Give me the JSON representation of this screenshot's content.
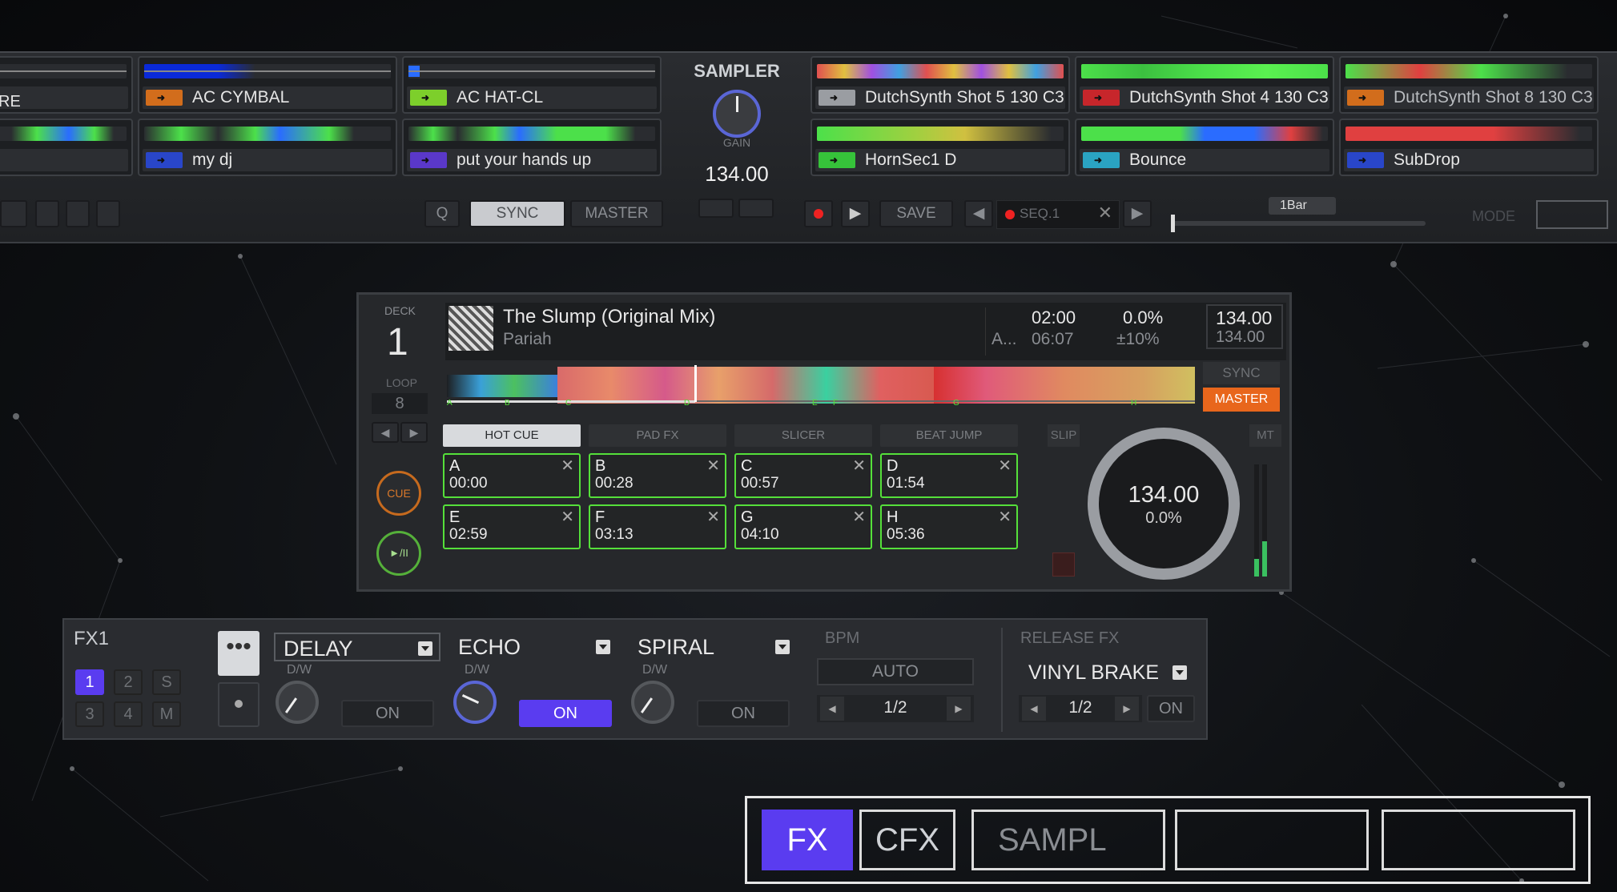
{
  "sampler": {
    "label": "SAMPLER",
    "gain_label": "GAIN",
    "bpm": "134.00",
    "slots_top_left": [
      {
        "name": "RE",
        "color": "#777a7e"
      },
      {
        "name": "AC CYMBAL",
        "color": "#d26d1c"
      },
      {
        "name": "AC HAT-CL",
        "color": "#7dcf2b"
      }
    ],
    "slots_bottom_left": [
      {
        "name": "",
        "color": "#777a7e"
      },
      {
        "name": "my dj",
        "color": "#2946c9"
      },
      {
        "name": "put your hands up",
        "color": "#5a38c9"
      }
    ],
    "slots_top_right": [
      {
        "name": "DutchSynth Shot 5 130 C3",
        "color": "#9a9da2"
      },
      {
        "name": "DutchSynth Shot 4 130 C3",
        "color": "#c7262b"
      },
      {
        "name": "DutchSynth Shot 8 130 C3",
        "color": "#d26d1c"
      }
    ],
    "slots_bottom_right": [
      {
        "name": "HornSec1  D",
        "color": "#36c23a"
      },
      {
        "name": "Bounce",
        "color": "#2aa3c2"
      },
      {
        "name": "SubDrop",
        "color": "#2946c9"
      }
    ],
    "controls": {
      "q": "Q",
      "sync": "SYNC",
      "master": "MASTER",
      "save": "SAVE",
      "seq": "SEQ.1",
      "bar": "1Bar",
      "mode": "MODE"
    }
  },
  "deck": {
    "deck_label": "DECK",
    "deck_number": "1",
    "loop_label": "LOOP",
    "loop_value": "8",
    "title": "The Slump (Original Mix)",
    "artist": "Pariah",
    "elapsed": "02:00",
    "total": "06:07",
    "key": "A...",
    "pitch": "0.0%",
    "range": "±10%",
    "bpm": "134.00",
    "orig_bpm": "134.00",
    "sync": "SYNC",
    "master": "MASTER",
    "slip": "SLIP",
    "mt": "MT",
    "cue": "CUE",
    "play": "►/II",
    "jog_bpm": "134.00",
    "jog_pitch": "0.0%",
    "marker_letters": [
      "A",
      "B",
      "C",
      "D",
      "E",
      "F",
      "G",
      "H"
    ],
    "tabs": [
      "HOT CUE",
      "PAD FX",
      "SLICER",
      "BEAT JUMP"
    ],
    "hotcues": [
      {
        "letter": "A",
        "time": "00:00"
      },
      {
        "letter": "B",
        "time": "00:28"
      },
      {
        "letter": "C",
        "time": "00:57"
      },
      {
        "letter": "D",
        "time": "01:54"
      },
      {
        "letter": "E",
        "time": "02:59"
      },
      {
        "letter": "F",
        "time": "03:13"
      },
      {
        "letter": "G",
        "time": "04:10"
      },
      {
        "letter": "H",
        "time": "05:36"
      }
    ]
  },
  "fx": {
    "label": "FX1",
    "assign_buttons": [
      "1",
      "2",
      "S",
      "3",
      "4",
      "M"
    ],
    "slots": [
      {
        "effect": "DELAY",
        "dw": "D/W",
        "on": "ON",
        "active": false
      },
      {
        "effect": "ECHO",
        "dw": "D/W",
        "on": "ON",
        "active": true
      },
      {
        "effect": "SPIRAL",
        "dw": "D/W",
        "on": "ON",
        "active": false
      }
    ],
    "bpm_label": "BPM",
    "auto": "AUTO",
    "beat": "1/2",
    "release_label": "RELEASE FX",
    "release_effect": "VINYL BRAKE",
    "release_beat": "1/2",
    "release_on": "ON"
  },
  "bottom_tabs": [
    "FX",
    "CFX",
    "SAMPL",
    "",
    ""
  ],
  "colors": {
    "accent": "#5a3cf0",
    "master": "#e8661c",
    "pad_border": "#55e03a"
  }
}
